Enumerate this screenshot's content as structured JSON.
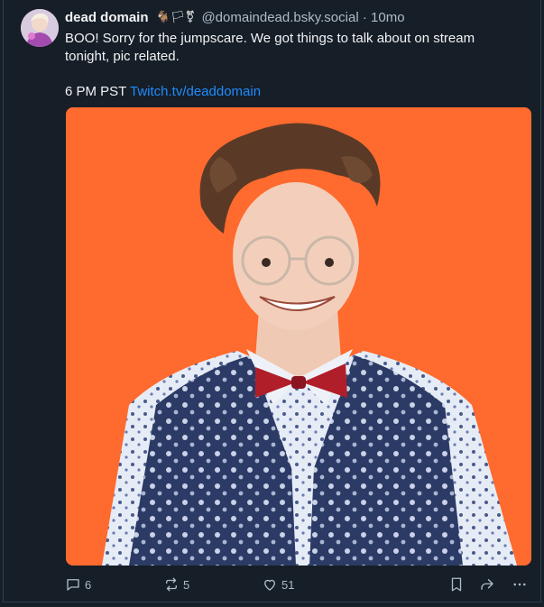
{
  "post": {
    "author": {
      "display_name": "dead domain",
      "badges": "🐐🏳⚧",
      "handle": "@domaindead.bsky.social"
    },
    "separator": "·",
    "time": "10mo",
    "text": "BOO! Sorry for the jumpscare. We got things to talk about on stream tonight, pic related.",
    "schedule_prefix": "6 PM PST ",
    "link_text": "Twitch.tv/deaddomain",
    "counts": {
      "replies": "6",
      "reposts": "5",
      "likes": "51"
    }
  },
  "colors": {
    "background": "#161e27",
    "text": "#f1f3f5",
    "muted": "#aebbc9",
    "link": "#208bfe",
    "photo_background": "#ff6a2e"
  },
  "icons": [
    "reply-icon",
    "repost-icon",
    "like-icon",
    "bookmark-icon",
    "share-icon",
    "more-icon"
  ]
}
